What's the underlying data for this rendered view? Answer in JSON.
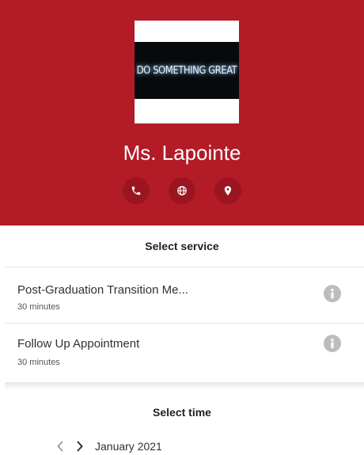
{
  "header": {
    "background_color": "#b31b27",
    "logo_text": "DO SOMETHING GREAT",
    "provider_name": "Ms. Lapointe",
    "contact_icons": [
      "phone-icon",
      "globe-icon",
      "location-pin-icon"
    ]
  },
  "services": {
    "title": "Select service",
    "items": [
      {
        "name": "Post-Graduation Transition Me...",
        "duration": "30 minutes",
        "icon": "info-icon"
      },
      {
        "name": "Follow Up Appointment",
        "duration": "30 minutes",
        "icon": "info-icon"
      }
    ]
  },
  "time": {
    "title": "Select time",
    "month_label": "January 2021",
    "prev_icon": "chevron-left-icon",
    "next_icon": "chevron-right-icon"
  }
}
